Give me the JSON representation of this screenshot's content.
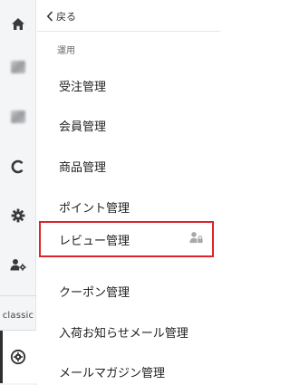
{
  "rail": {
    "classic_label": "classic",
    "items": [
      {
        "icon": "home-icon"
      },
      {
        "icon": "blurred-icon"
      },
      {
        "icon": "blurred-icon"
      },
      {
        "icon": "c-brand-icon"
      },
      {
        "icon": "gear-icon"
      },
      {
        "icon": "user-gear-icon"
      },
      {
        "icon": "operation-gear-icon",
        "active": true
      }
    ]
  },
  "menu": {
    "back_label": "戻る",
    "section_label": "運用",
    "items": [
      {
        "label": "受注管理"
      },
      {
        "label": "会員管理"
      },
      {
        "label": "商品管理"
      },
      {
        "label": "ポイント管理"
      },
      {
        "label": "レビュー管理",
        "highlighted": true,
        "trailing_icon": "user-lock-icon"
      },
      {
        "label": "クーポン管理"
      },
      {
        "label": "入荷お知らせメール管理"
      },
      {
        "label": "メールマガジン管理"
      }
    ]
  },
  "colors": {
    "highlight_border": "#d9252b",
    "rail_background": "#f4f5f7",
    "text": "#222222"
  }
}
